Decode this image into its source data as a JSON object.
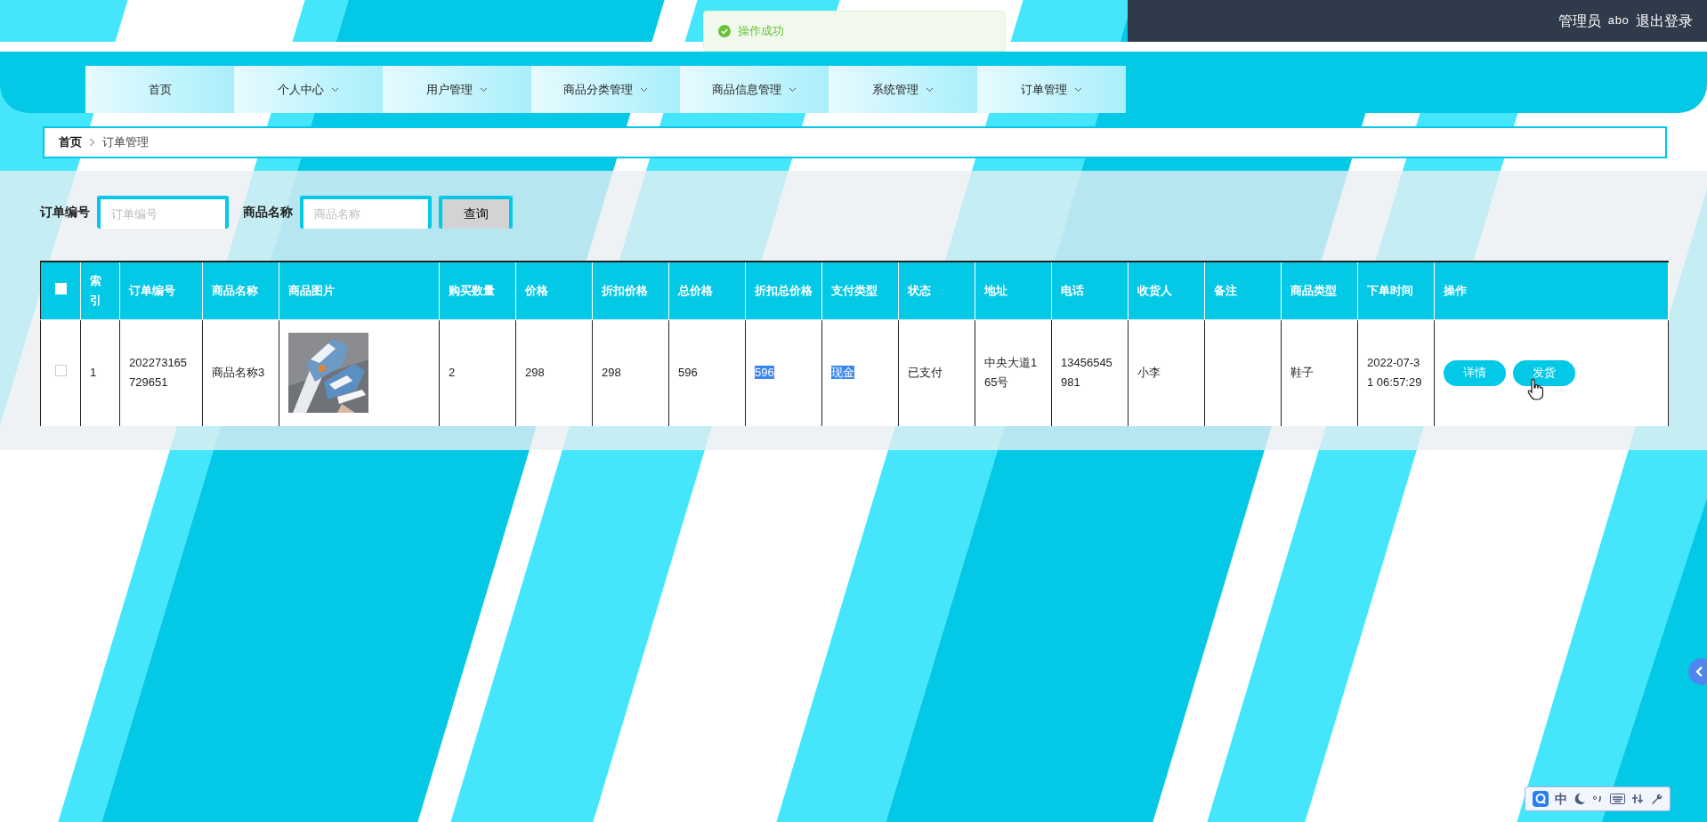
{
  "header": {
    "user_role": "管理员",
    "username": "abo",
    "logout": "退出登录"
  },
  "toast": {
    "message": "操作成功"
  },
  "nav": [
    {
      "label": "首页",
      "has_dropdown": false
    },
    {
      "label": "个人中心",
      "has_dropdown": true
    },
    {
      "label": "用户管理",
      "has_dropdown": true
    },
    {
      "label": "商品分类管理",
      "has_dropdown": true
    },
    {
      "label": "商品信息管理",
      "has_dropdown": true
    },
    {
      "label": "系统管理",
      "has_dropdown": true
    },
    {
      "label": "订单管理",
      "has_dropdown": true
    }
  ],
  "breadcrumb": [
    {
      "label": "首页",
      "current": false
    },
    {
      "label": "订单管理",
      "current": true
    }
  ],
  "search": {
    "fields": [
      {
        "label": "订单编号",
        "placeholder": "订单编号"
      },
      {
        "label": "商品名称",
        "placeholder": "商品名称"
      }
    ],
    "button": "查询"
  },
  "table": {
    "select_all_checked": false,
    "columns": [
      "索引",
      "订单编号",
      "商品名称",
      "商品图片",
      "购买数量",
      "价格",
      "折扣价格",
      "总价格",
      "折扣总价格",
      "支付类型",
      "状态",
      "地址",
      "电话",
      "收货人",
      "备注",
      "商品类型",
      "下单时间",
      "操作"
    ],
    "rows": [
      {
        "checked": false,
        "cells": [
          {
            "kind": "text",
            "text": "1",
            "highlighted": false
          },
          {
            "kind": "text",
            "text": "202273165729651",
            "highlighted": false
          },
          {
            "kind": "text",
            "text": "商品名称3",
            "highlighted": false
          },
          {
            "kind": "picture"
          },
          {
            "kind": "text",
            "text": "2",
            "highlighted": false
          },
          {
            "kind": "text",
            "text": "298",
            "highlighted": false
          },
          {
            "kind": "text",
            "text": "298",
            "highlighted": false
          },
          {
            "kind": "text",
            "text": "596",
            "highlighted": false
          },
          {
            "kind": "text",
            "text": "596",
            "highlighted": true
          },
          {
            "kind": "text",
            "text": "现金",
            "highlighted": true
          },
          {
            "kind": "text",
            "text": "已支付",
            "highlighted": false
          },
          {
            "kind": "text",
            "text": "中央大道165号",
            "highlighted": false
          },
          {
            "kind": "text",
            "text": "13456545981",
            "highlighted": false
          },
          {
            "kind": "text",
            "text": "小李",
            "highlighted": false
          },
          {
            "kind": "empty"
          },
          {
            "kind": "text",
            "text": "鞋子",
            "highlighted": false
          },
          {
            "kind": "text",
            "text": "2022-07-31 06:57:29",
            "highlighted": false
          },
          {
            "kind": "actions",
            "buttons": [
              "详情",
              "发货"
            ]
          }
        ]
      }
    ]
  },
  "ime_toolbar": {
    "mode": "中"
  }
}
